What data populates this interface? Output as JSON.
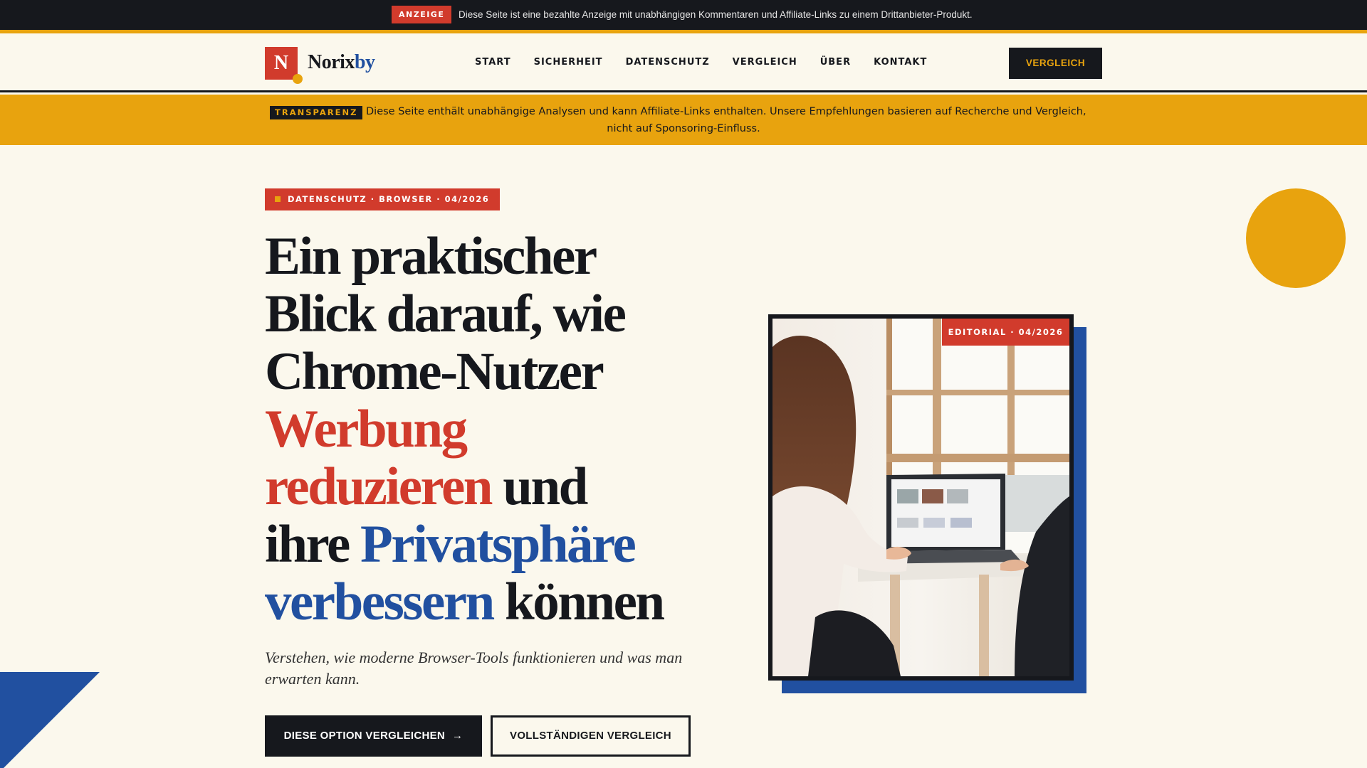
{
  "ad_bar": {
    "badge": "ANZEIGE",
    "text": "Diese Seite ist eine bezahlte Anzeige mit unabhängigen Kommentaren und Affiliate-Links zu einem Drittanbieter-Produkt."
  },
  "header": {
    "logo_letter": "N",
    "logo_part1": "Norix",
    "logo_part2": "by",
    "nav": [
      "START",
      "SICHERHEIT",
      "DATENSCHUTZ",
      "VERGLEICH",
      "ÜBER",
      "KONTAKT"
    ],
    "cta_label": "VERGLEICH"
  },
  "transparency": {
    "badge": "TRANSPARENZ",
    "line1": "Diese Seite enthält unabhängige Analysen und kann Affiliate-Links enthalten. Unsere Empfehlungen basieren auf Recherche und Vergleich,",
    "line2": "nicht auf Sponsoring-Einfluss."
  },
  "hero": {
    "kicker": "DATENSCHUTZ · BROWSER · 04/2026",
    "headline": {
      "p1": "Ein praktischer",
      "p2": "Blick darauf, wie",
      "p3": "Chrome-Nutzer",
      "p4_red": "Werbung",
      "p5_red": "reduzieren",
      "p5_rest": " und",
      "p6_start": "ihre ",
      "p6_blue": "Privatsphäre",
      "p7_blue": "verbessern",
      "p7_rest": " können"
    },
    "subtitle": "Verstehen, wie moderne Browser-Tools funktionieren und was man erwarten kann.",
    "primary_button": "DIESE OPTION VERGLEICHEN",
    "primary_arrow": "→",
    "secondary_button": "VOLLSTÄNDIGEN VERGLEICH"
  },
  "image_card": {
    "tag": "EDITORIAL · 04/2026"
  },
  "colors": {
    "red": "#d13b2c",
    "blue": "#2150a0",
    "yellow": "#e8a30e",
    "dark": "#16181d",
    "background": "#fbf8ed"
  }
}
